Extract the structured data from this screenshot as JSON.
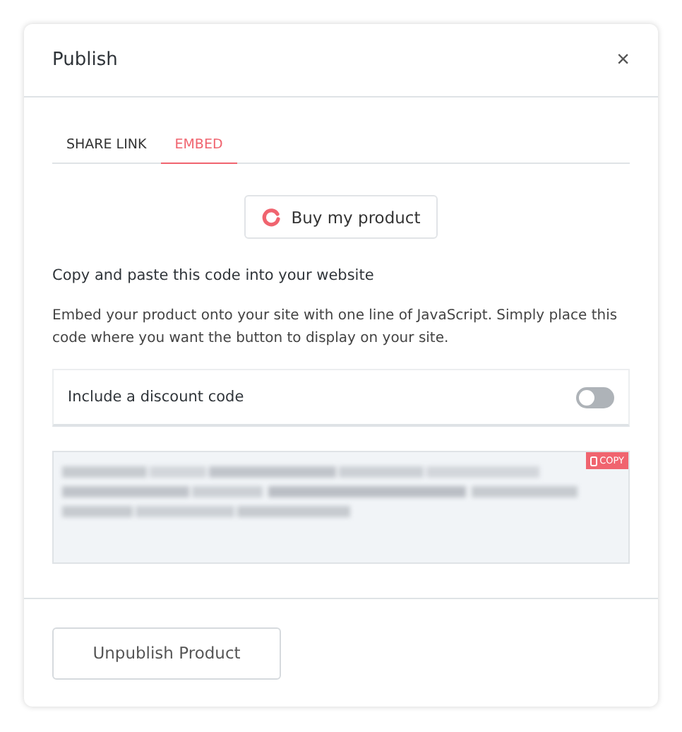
{
  "dialog": {
    "title": "Publish",
    "close": "×"
  },
  "tabs": [
    {
      "label": "SHARE LINK",
      "selected": false
    },
    {
      "label": "EMBED",
      "selected": true
    }
  ],
  "preview_button": {
    "label": "Buy my product"
  },
  "heading": "Copy and paste this code into your website",
  "description": "Embed your product onto your site with one line of JavaScript. Simply place this code where you want the button to display on your site.",
  "discount_toggle": {
    "label": "Include a discount code",
    "on": false
  },
  "code_box": {
    "copy_label": "COPY"
  },
  "footer_button": "Unpublish Product"
}
